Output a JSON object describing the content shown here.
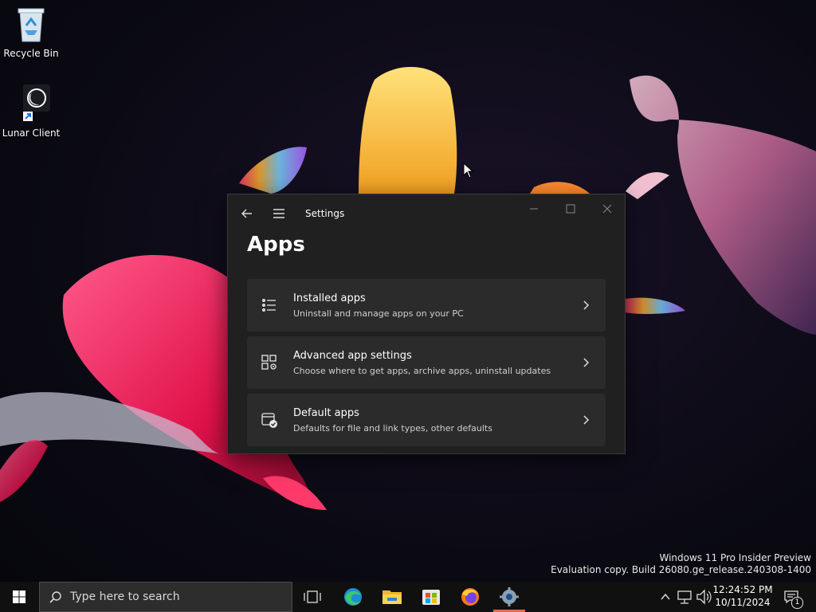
{
  "desktop": {
    "icons": [
      {
        "label": "Recycle Bin",
        "icon": "recycle-bin-icon"
      },
      {
        "label": "Lunar Client",
        "icon": "lunar-client-icon"
      }
    ],
    "watermark": {
      "line1": "Windows 11 Pro Insider Preview",
      "line2": "Evaluation copy. Build 26080.ge_release.240308-1400"
    }
  },
  "window": {
    "title": "Settings",
    "page_title": "Apps",
    "cards": [
      {
        "title": "Installed apps",
        "description": "Uninstall and manage apps on your PC",
        "icon": "list-icon"
      },
      {
        "title": "Advanced app settings",
        "description": "Choose where to get apps, archive apps, uninstall updates",
        "icon": "app-settings-icon"
      },
      {
        "title": "Default apps",
        "description": "Defaults for file and link types, other defaults",
        "icon": "default-apps-icon"
      }
    ]
  },
  "taskbar": {
    "search_placeholder": "Type here to search",
    "apps": [
      "task-view-icon",
      "edge-icon",
      "file-explorer-icon",
      "store-icon",
      "firefox-icon",
      "settings-icon"
    ],
    "clock": {
      "time": "12:24:52 PM",
      "date": "10/11/2024"
    },
    "notification_count": "1"
  },
  "colors": {
    "taskbar_bg": "#101010",
    "window_bg": "#202020",
    "card_bg": "#2b2b2b",
    "active_indicator": "#e06c4c"
  }
}
